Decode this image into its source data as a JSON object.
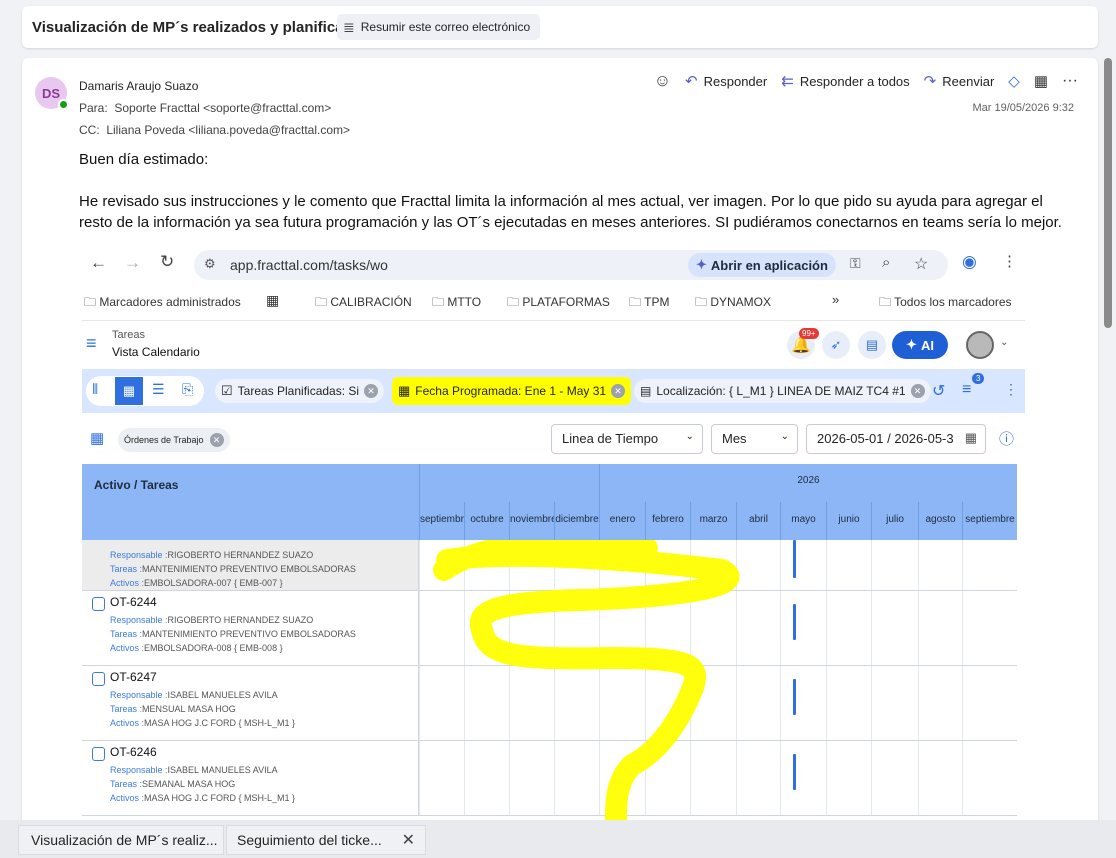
{
  "subject_bar": {
    "subject": "Visualización de MP´s realizados y planificados",
    "summarize_label": "Resumir este correo electrónico"
  },
  "email": {
    "avatar_initials": "DS",
    "sender": "Damaris Araujo Suazo",
    "to_label": "Para:",
    "to": "Soporte Fracttal <soporte@fracttal.com>",
    "cc_label": "CC:",
    "cc": "Liliana Poveda <liliana.poveda@fracttal.com>",
    "date": "Mar 19/05/2026 9:32",
    "actions": {
      "reply": "Responder",
      "reply_all": "Responder a todos",
      "forward": "Reenviar"
    },
    "body": {
      "greeting": "Buen día estimado:",
      "paragraph": "He revisado sus instrucciones y le comento que Fracttal limita la información al mes actual, ver imagen. Por lo que pido su ayuda para agregar el resto de la información ya sea futura programación y las OT´s ejecutadas en meses anteriores.  SI pudiéramos conectarnos en teams sería lo mejor."
    }
  },
  "browser": {
    "url": "app.fracttal.com/tasks/wo",
    "open_in_app": "Abrir en aplicación",
    "bookmarks": [
      "Marcadores administrados",
      "CALIBRACIÓN",
      "MTTO",
      "PLATAFORMAS",
      "TPM",
      "DYNAMOX"
    ],
    "all_bookmarks": "Todos los marcadores"
  },
  "app": {
    "section": "Tareas",
    "view": "Vista Calendario",
    "notif_badge": "99+",
    "ai_label": "AI",
    "filter_badge": "3",
    "filters": {
      "planned": "Tareas Planificadas: Si",
      "date": "Fecha Programada: Ene 1 - May 31",
      "location": "Localización: { L_M1 } LINEA DE MAIZ TC4 #1"
    },
    "orders_chip": "Órdenes de Trabajo",
    "timeline_select": "Linea de Tiempo",
    "period_select": "Mes",
    "date_range": "2026-05-01 / 2026-05-3",
    "gantt": {
      "left_header": "Activo / Tareas",
      "year": "2026",
      "months": [
        "septiembre",
        "octubre",
        "noviembre",
        "diciembre",
        "enero",
        "febrero",
        "marzo",
        "abril",
        "mayo",
        "junio",
        "julio",
        "agosto",
        "septiembre"
      ],
      "rows": [
        {
          "id": "",
          "responsable": "RIGOBERTO HERNANDEZ SUAZO",
          "tareas": "MANTENIMIENTO PREVENTIVO EMBOLSADORAS",
          "activos": "EMBOLSADORA-007 { EMB-007 }"
        },
        {
          "id": "OT-6244",
          "responsable": "RIGOBERTO HERNANDEZ SUAZO",
          "tareas": "MANTENIMIENTO PREVENTIVO EMBOLSADORAS",
          "activos": "EMBOLSADORA-008 { EMB-008 }"
        },
        {
          "id": "OT-6247",
          "responsable": "ISABEL MANUELES AVILA",
          "tareas": "MENSUAL MASA HOG",
          "activos": "MASA HOG J.C FORD { MSH-L_M1 }"
        },
        {
          "id": "OT-6246",
          "responsable": "ISABEL MANUELES AVILA",
          "tareas": "SEMANAL MASA HOG",
          "activos": "MASA HOG J.C FORD { MSH-L_M1 }"
        }
      ],
      "label_responsable": "Responsable :",
      "label_tareas": "Tareas :",
      "label_activos": "Activos :"
    }
  },
  "taskbar": {
    "tab1": "Visualización de MP´s realiz...",
    "tab2": "Seguimiento del ticke..."
  },
  "colors": {
    "highlight": "#ffff00",
    "accent": "#5b5fc7",
    "gantt_header": "#8cb6f6"
  }
}
